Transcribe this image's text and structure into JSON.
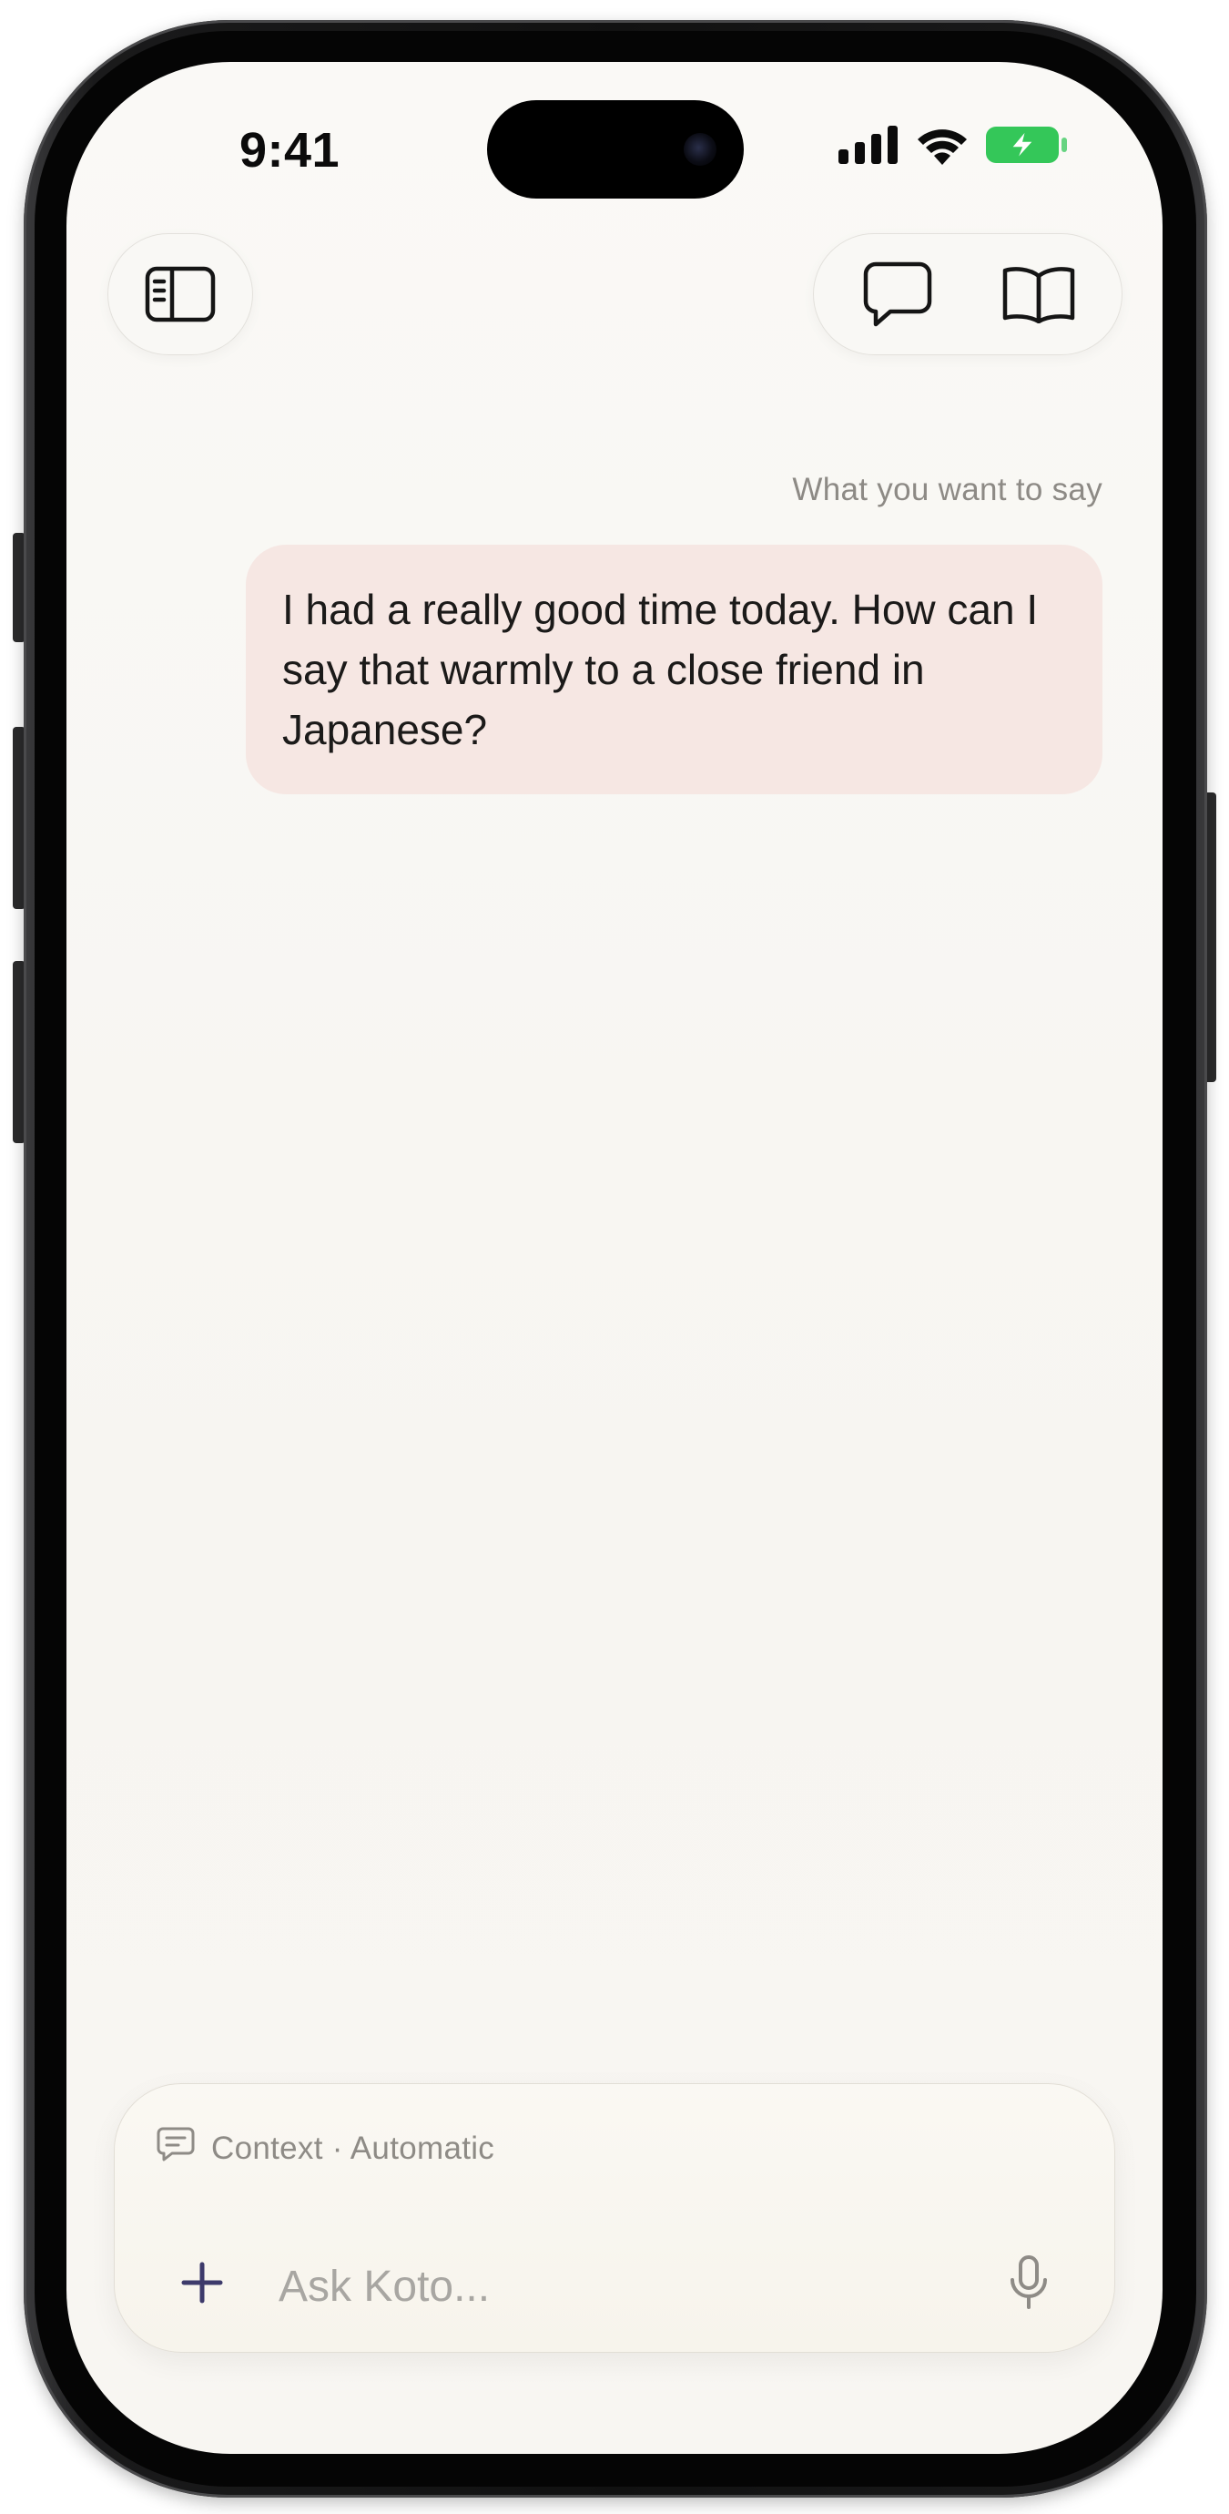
{
  "status_bar": {
    "time": "9:41",
    "battery_color": "#34c759"
  },
  "header": {
    "sidebar_icon": "sidebar-icon",
    "chat_icon": "chat-bubble-icon",
    "book_icon": "book-icon"
  },
  "conversation": {
    "caption": "What you want to say",
    "user_message": "I had a really good time today. How can I say that warmly to a close friend in Japanese?",
    "bubble_color": "#f6e7e3"
  },
  "composer": {
    "context_label": "Context · Automatic",
    "placeholder": "Ask Koto...",
    "value": "",
    "accent_color": "#3d3a6b"
  }
}
